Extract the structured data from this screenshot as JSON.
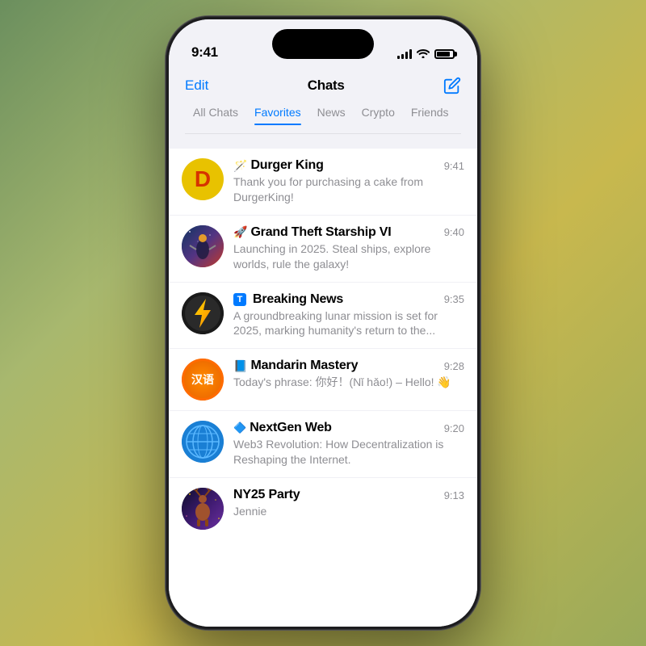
{
  "phone": {
    "time": "9:41",
    "header": {
      "edit_label": "Edit",
      "title": "Chats",
      "compose_label": "compose"
    },
    "tabs": [
      {
        "id": "all",
        "label": "All Chats",
        "active": false
      },
      {
        "id": "favorites",
        "label": "Favorites",
        "active": true
      },
      {
        "id": "news",
        "label": "News",
        "active": false
      },
      {
        "id": "crypto",
        "label": "Crypto",
        "active": false
      },
      {
        "id": "friends",
        "label": "Friends",
        "active": false
      }
    ],
    "chats": [
      {
        "id": "durger-king",
        "name": "Durger King",
        "icon": "🪄",
        "avatar_type": "durger",
        "avatar_letter": "D",
        "time": "9:41",
        "preview": "Thank you for purchasing a cake from DurgerKing!"
      },
      {
        "id": "grand-theft-starship",
        "name": "Grand Theft Starship VI",
        "icon": "🚀",
        "avatar_type": "gts",
        "time": "9:40",
        "preview": "Launching in 2025. Steal ships, explore worlds, rule the galaxy!"
      },
      {
        "id": "breaking-news",
        "name": "Breaking News",
        "icon": "🇹",
        "avatar_type": "news",
        "time": "9:35",
        "preview": "A groundbreaking lunar mission is set for 2025, marking humanity's return to the..."
      },
      {
        "id": "mandarin-mastery",
        "name": "Mandarin Mastery",
        "icon": "📘",
        "avatar_type": "mandarin",
        "avatar_text": "汉语",
        "time": "9:28",
        "preview": "Today's phrase:\n你好！(Nǐ hǎo!) – Hello! 👋"
      },
      {
        "id": "nextgen-web",
        "name": "NextGen Web",
        "icon": "🔷",
        "avatar_type": "web",
        "time": "9:20",
        "preview": "Web3 Revolution: How Decentralization is Reshaping the Internet."
      },
      {
        "id": "ny25-party",
        "name": "NY25 Party",
        "icon": "",
        "avatar_type": "ny25",
        "time": "9:13",
        "preview": "Jennie"
      }
    ]
  }
}
